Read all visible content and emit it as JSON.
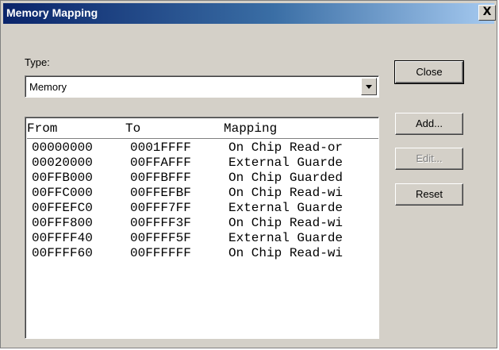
{
  "window": {
    "title": "Memory Mapping",
    "close_glyph": "X"
  },
  "type_field": {
    "label": "Type:",
    "value": "Memory"
  },
  "list": {
    "headers": [
      "From",
      "To",
      "Mapping"
    ],
    "rows": [
      {
        "from": "00000000",
        "to": "0001FFFF",
        "mapping": "On Chip Read-or"
      },
      {
        "from": "00020000",
        "to": "00FFAFFF",
        "mapping": "External Guarde"
      },
      {
        "from": "00FFB000",
        "to": "00FFBFFF",
        "mapping": "On Chip Guarded"
      },
      {
        "from": "00FFC000",
        "to": "00FFEFBF",
        "mapping": "On Chip Read-wi"
      },
      {
        "from": "00FFEFC0",
        "to": "00FFF7FF",
        "mapping": "External Guarde"
      },
      {
        "from": "00FFF800",
        "to": "00FFFF3F",
        "mapping": "On Chip Read-wi"
      },
      {
        "from": "00FFFF40",
        "to": "00FFFF5F",
        "mapping": "External Guarde"
      },
      {
        "from": "00FFFF60",
        "to": "00FFFFFF",
        "mapping": "On Chip Read-wi"
      }
    ]
  },
  "buttons": {
    "close": "Close",
    "add": "Add...",
    "edit": "Edit...",
    "reset": "Reset"
  },
  "icons": {
    "dropdown": "chevron-down-icon",
    "window_close": "close-icon"
  }
}
